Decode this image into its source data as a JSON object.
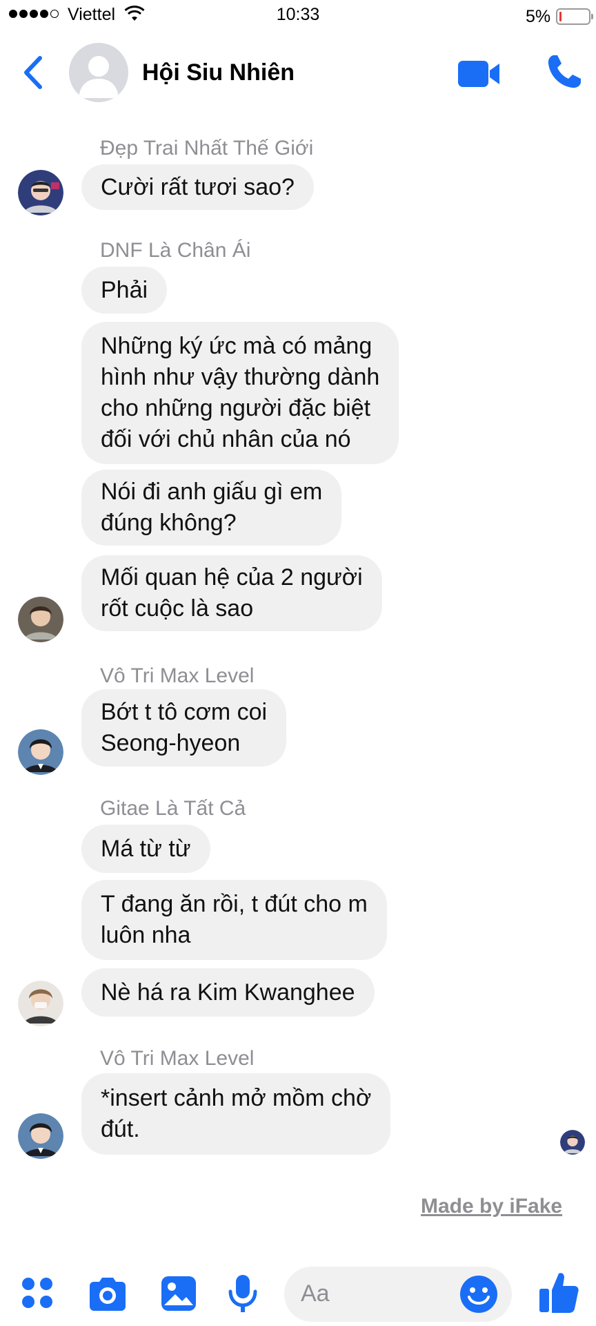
{
  "status_bar": {
    "carrier": "Viettel",
    "time": "10:33",
    "battery": "5%"
  },
  "header": {
    "title": "Hội Siu Nhiên"
  },
  "messages": [
    {
      "sender": "Đẹp Trai Nhất Thế Giới",
      "bubbles": [
        "Cười rất tươi sao?"
      ]
    },
    {
      "sender": "DNF Là Chân Ái",
      "bubbles": [
        "Phải",
        "Những ký ức mà có mảng\nhình như vậy thường dành\ncho những người đặc biệt\nđối với chủ nhân của nó",
        "Nói đi anh giấu gì em\nđúng không?",
        "Mối quan hệ của 2 người\nrốt cuộc là sao"
      ]
    },
    {
      "sender": "Vô Tri Max Level",
      "bubbles": [
        "Bớt t tô cơm coi\nSeong-hyeon"
      ]
    },
    {
      "sender": "Gitae Là Tất Cả",
      "bubbles": [
        "Má từ từ",
        "T đang ăn rồi, t đút cho m\nluôn nha",
        "Nè há ra Kim Kwanghee"
      ]
    },
    {
      "sender": "Vô Tri Max Level",
      "bubbles": [
        "*insert cảnh mở mồm chờ\nđút."
      ]
    }
  ],
  "watermark": "Made by iFake",
  "composer": {
    "placeholder": "Aa"
  },
  "colors": {
    "accent": "#1a6ef5",
    "bubble": "#f0f0f0",
    "sender": "#8e8e93"
  }
}
